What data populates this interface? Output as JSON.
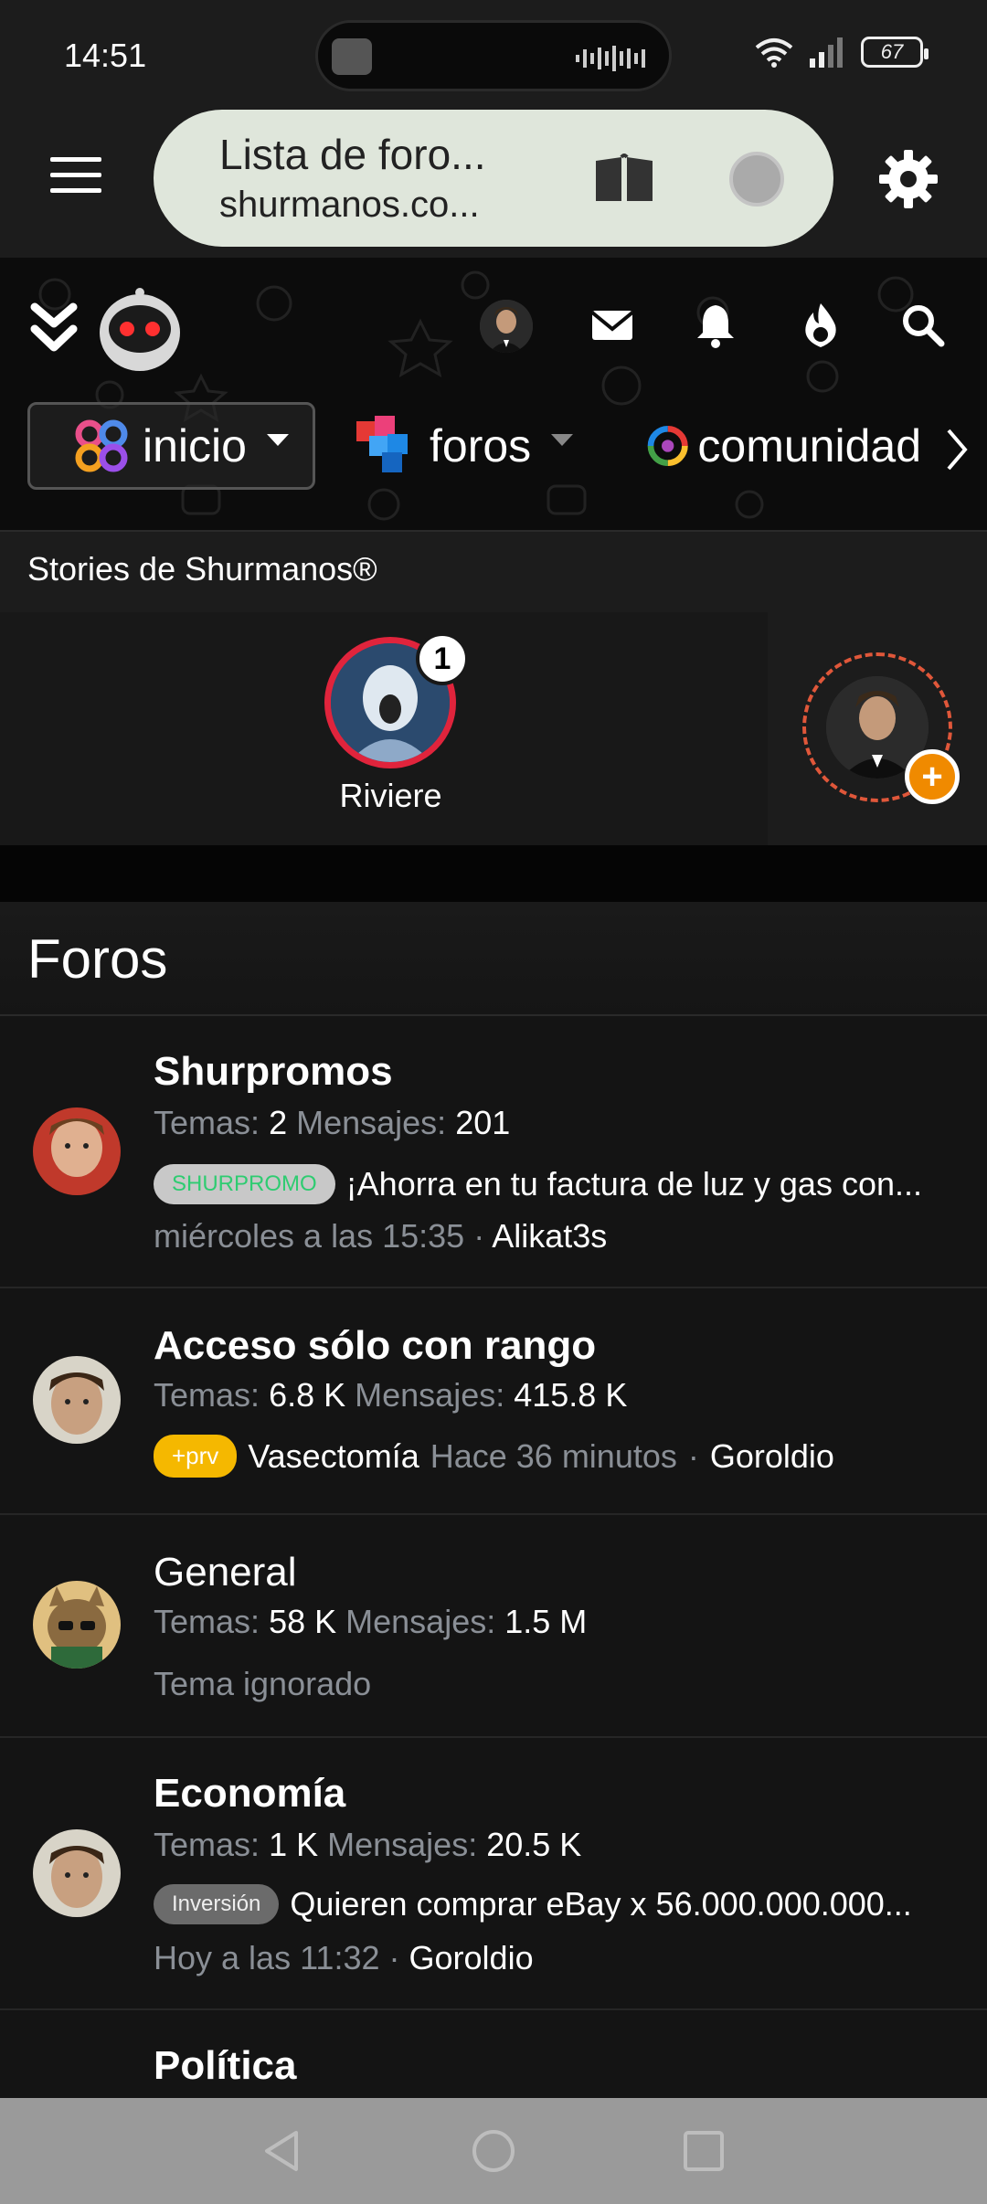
{
  "status": {
    "time": "14:51",
    "battery": "67"
  },
  "browser": {
    "tab_title": "Lista de foro...",
    "url": "shurmanos.co..."
  },
  "site_nav": {
    "items": [
      {
        "label": "inicio"
      },
      {
        "label": "foros"
      },
      {
        "label": "comunidad"
      }
    ],
    "watermark": "shurmanos"
  },
  "stories": {
    "title": "Stories de Shurmanos®",
    "items": [
      {
        "name": "Riviere",
        "count": "1"
      }
    ]
  },
  "forums": {
    "title": "Foros",
    "topics_label": "Temas:",
    "messages_label": "Mensajes:",
    "rows": [
      {
        "name": "Shurpromos",
        "topics": "2",
        "messages": "201",
        "tag": "SHURPROMO",
        "last_title": "¡Ahorra en tu factura de luz y gas con...",
        "when": "miércoles a las 15:35",
        "separator": "·",
        "who": "Alikat3s"
      },
      {
        "name": "Acceso sólo con rango",
        "topics": "6.8 K",
        "messages": "415.8 K",
        "tag": "+prv",
        "last_title": "Vasectomía",
        "when": "Hace 36 minutos",
        "separator": "·",
        "who": "Goroldio"
      },
      {
        "name": "General",
        "topics": "58 K",
        "messages": "1.5 M",
        "ignored": "Tema ignorado"
      },
      {
        "name": "Economía",
        "topics": "1 K",
        "messages": "20.5 K",
        "tag": "Inversión",
        "last_title": "Quieren comprar eBay x 56.000.000.000...",
        "when": "Hoy a las 11:32",
        "separator": "·",
        "who": "Goroldio"
      },
      {
        "name": "Política"
      }
    ]
  }
}
